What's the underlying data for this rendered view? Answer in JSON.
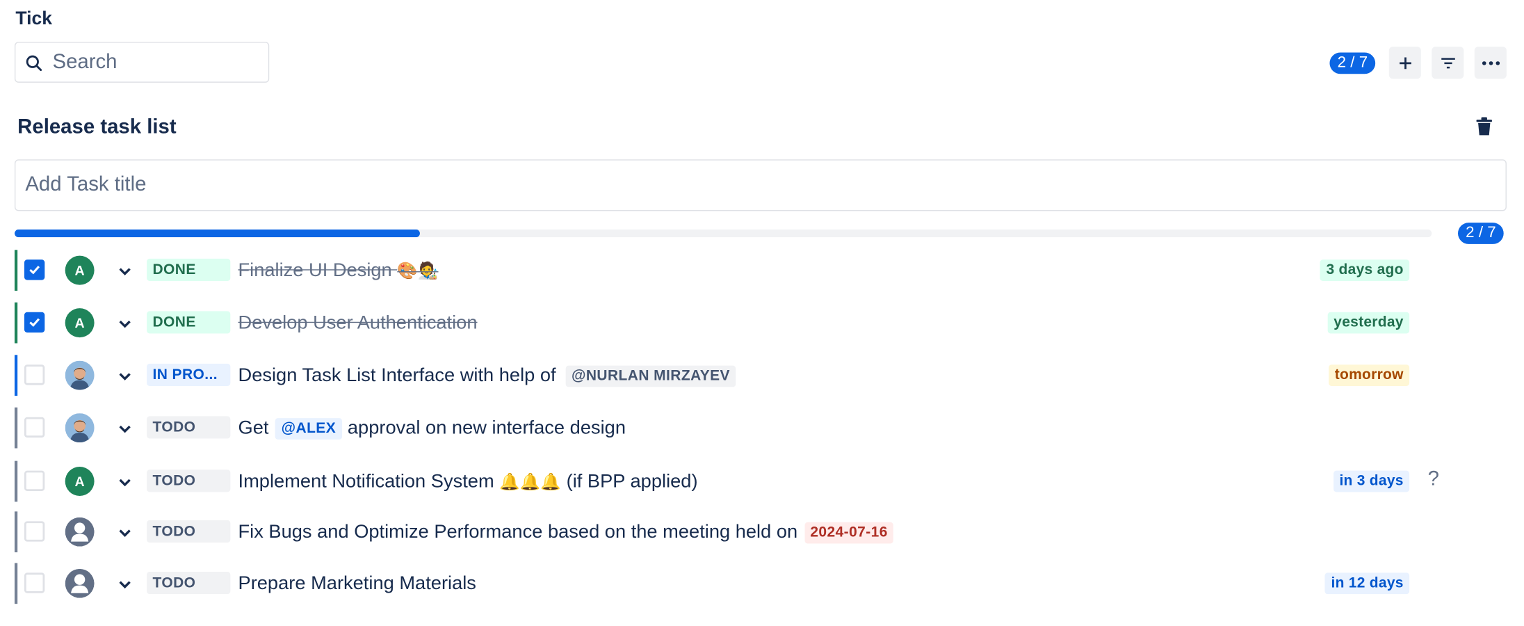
{
  "app": {
    "title": "Tick"
  },
  "search": {
    "placeholder": "Search"
  },
  "toolbar": {
    "count": "2 / 7",
    "add_icon": "plus-icon",
    "filter_icon": "filter-icon",
    "more_icon": "more-horizontal-icon"
  },
  "list": {
    "title": "Release task list",
    "delete_icon": "trash-icon"
  },
  "add_task": {
    "placeholder": "Add Task title"
  },
  "progress": {
    "completed": 2,
    "total": 7,
    "fraction": 0.2857,
    "label": "2 / 7"
  },
  "colors": {
    "accent": "#0c66e4",
    "done": "#1f845a",
    "in_progress": "#0c66e4",
    "todo": "#758195",
    "overdue_date": "#ae2e24"
  },
  "tasks": [
    {
      "checked": true,
      "status": "DONE",
      "avatar": "A",
      "title_parts": {
        "before": "Finalize UI Design ",
        "emoji": "🎨🧑‍🎨"
      },
      "due": "3 days ago"
    },
    {
      "checked": true,
      "status": "DONE",
      "avatar": "A",
      "title_parts": {
        "before": "Develop User Authentication"
      },
      "due": "yesterday"
    },
    {
      "checked": false,
      "status": "IN PRO...",
      "avatar": "person-photo",
      "title_parts": {
        "before": "Design Task List Interface with help of",
        "mention": "@NURLAN MIRZAYEV"
      },
      "due": "tomorrow"
    },
    {
      "checked": false,
      "status": "TODO",
      "avatar": "person-photo",
      "title_parts": {
        "before": "Get",
        "mention": "@ALEX",
        "after": "approval on new interface design"
      }
    },
    {
      "checked": false,
      "status": "TODO",
      "avatar": "A",
      "title_parts": {
        "before": "Implement Notification System ",
        "emoji": "🔔🔔🔔",
        "after": " (if BPP applied)"
      },
      "due": "in 3 days",
      "help": "?"
    },
    {
      "checked": false,
      "status": "TODO",
      "avatar": "unassigned",
      "title_parts": {
        "before": "Fix Bugs and Optimize Performance based on the meeting held on",
        "date": "2024-07-16"
      }
    },
    {
      "checked": false,
      "status": "TODO",
      "avatar": "unassigned",
      "title_parts": {
        "before": "Prepare Marketing Materials"
      },
      "due": "in 12 days"
    }
  ]
}
